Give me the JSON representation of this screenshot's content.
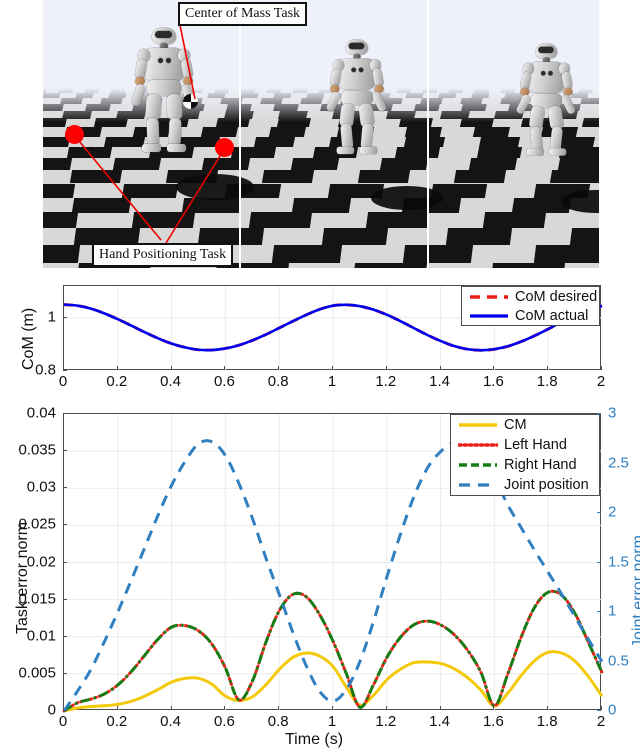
{
  "figure": {
    "photo": {
      "annotations": [
        {
          "id": "com-task",
          "label": "Center of Mass Task"
        },
        {
          "id": "hand-task",
          "label": "Hand Positioning Task"
        }
      ],
      "markers": [
        "left-hand-target",
        "right-hand-target",
        "center-of-mass-marker"
      ],
      "frames": 3
    },
    "colors": {
      "com_desired": "#e81c15",
      "com_actual": "#0000ee",
      "cm": "#f4c90a",
      "left_hand": "#e8221a",
      "right_hand": "#157d15",
      "joint_position": "#2f7fc1",
      "axis": "#4d4d4d",
      "grid": "#ebebeb"
    }
  },
  "chart_data": [
    {
      "id": "com-plot",
      "type": "line",
      "title": "",
      "xlabel": "",
      "ylabel": "CoM (m)",
      "xlim": [
        0,
        2
      ],
      "ylim": [
        0.8,
        1.12
      ],
      "xticks": [
        0,
        0.2,
        0.4,
        0.6,
        0.8,
        1,
        1.2,
        1.4,
        1.6,
        1.8,
        2
      ],
      "xticklabels": [
        "0",
        "0.2",
        "0.4",
        "0.6",
        "0.8",
        "1",
        "1.2",
        "1.4",
        "1.6",
        "1.8",
        "2"
      ],
      "yticks": [
        0.8,
        1
      ],
      "yticklabels": [
        "0.8",
        "1"
      ],
      "grid": true,
      "legend_position": "top-right",
      "legend": [
        "CoM desired",
        "CoM actual"
      ],
      "x": [
        0,
        0.05,
        0.1,
        0.15,
        0.2,
        0.25,
        0.3,
        0.35,
        0.4,
        0.45,
        0.5,
        0.55,
        0.6,
        0.65,
        0.7,
        0.75,
        0.8,
        0.85,
        0.9,
        0.95,
        1,
        1.05,
        1.1,
        1.15,
        1.2,
        1.25,
        1.3,
        1.35,
        1.4,
        1.45,
        1.5,
        1.55,
        1.6,
        1.65,
        1.7,
        1.75,
        1.8,
        1.85,
        1.9,
        1.95,
        2
      ],
      "series": [
        {
          "name": "CoM desired",
          "values": [
            1.05,
            1.046,
            1.035,
            1.017,
            0.995,
            0.971,
            0.946,
            0.923,
            0.903,
            0.889,
            0.88,
            0.879,
            0.885,
            0.897,
            0.915,
            0.937,
            0.962,
            0.987,
            1.011,
            1.032,
            1.046,
            1.049,
            1.044,
            1.031,
            1.012,
            0.988,
            0.962,
            0.936,
            0.913,
            0.894,
            0.882,
            0.878,
            0.882,
            0.893,
            0.911,
            0.933,
            0.958,
            0.984,
            1.008,
            1.029,
            1.045
          ]
        },
        {
          "name": "CoM actual",
          "values": [
            1.05,
            1.046,
            1.035,
            1.017,
            0.995,
            0.971,
            0.946,
            0.923,
            0.903,
            0.889,
            0.88,
            0.879,
            0.885,
            0.897,
            0.915,
            0.937,
            0.962,
            0.987,
            1.011,
            1.032,
            1.046,
            1.049,
            1.044,
            1.031,
            1.012,
            0.988,
            0.962,
            0.936,
            0.913,
            0.894,
            0.882,
            0.878,
            0.882,
            0.893,
            0.911,
            0.933,
            0.958,
            0.984,
            1.008,
            1.029,
            1.045
          ]
        }
      ]
    },
    {
      "id": "error-plot",
      "type": "line",
      "title": "",
      "xlabel": "Time (s)",
      "ylabel": "Task error norm",
      "ylabel_right": "Joint error norm",
      "xlim": [
        0,
        2
      ],
      "ylim": [
        0,
        0.04
      ],
      "ylim_right": [
        0,
        3
      ],
      "xticks": [
        0,
        0.2,
        0.4,
        0.6,
        0.8,
        1,
        1.2,
        1.4,
        1.6,
        1.8,
        2
      ],
      "xticklabels": [
        "0",
        "0.2",
        "0.4",
        "0.6",
        "0.8",
        "1",
        "1.2",
        "1.4",
        "1.6",
        "1.8",
        "2"
      ],
      "yticks": [
        0,
        0.005,
        0.01,
        0.015,
        0.02,
        0.025,
        0.03,
        0.035,
        0.04
      ],
      "yticklabels": [
        "0",
        "0.005",
        "0.01",
        "0.015",
        "0.02",
        "0.025",
        "0.03",
        "0.035",
        "0.04"
      ],
      "yticks_right": [
        0,
        0.5,
        1,
        1.5,
        2,
        2.5,
        3
      ],
      "yticklabels_right": [
        "0",
        "0.5",
        "1",
        "1.5",
        "2",
        "2.5",
        "3"
      ],
      "grid": true,
      "legend_position": "top-right",
      "legend": [
        "CM",
        "Left Hand",
        "Right Hand",
        "Joint position"
      ],
      "x": [
        0,
        0.05,
        0.1,
        0.15,
        0.2,
        0.25,
        0.3,
        0.35,
        0.4,
        0.45,
        0.5,
        0.55,
        0.6,
        0.65,
        0.7,
        0.75,
        0.8,
        0.85,
        0.9,
        0.95,
        1,
        1.05,
        1.1,
        1.15,
        1.2,
        1.25,
        1.3,
        1.35,
        1.4,
        1.45,
        1.5,
        1.55,
        1.6,
        1.65,
        1.7,
        1.75,
        1.8,
        1.85,
        1.9,
        1.95,
        2
      ],
      "series": [
        {
          "name": "CM",
          "axis": "left",
          "values": [
            0.0,
            0.0004,
            0.0006,
            0.0007,
            0.0009,
            0.0013,
            0.002,
            0.0029,
            0.0039,
            0.0044,
            0.0044,
            0.0036,
            0.002,
            0.0014,
            0.0019,
            0.0035,
            0.0056,
            0.0072,
            0.0078,
            0.0074,
            0.006,
            0.0032,
            0.0008,
            0.0021,
            0.0042,
            0.0056,
            0.0065,
            0.0066,
            0.0064,
            0.0057,
            0.0045,
            0.0028,
            0.0007,
            0.0024,
            0.0048,
            0.0068,
            0.0079,
            0.0078,
            0.0067,
            0.0046,
            0.002
          ]
        },
        {
          "name": "Left Hand",
          "axis": "left",
          "values": [
            0.0,
            0.0011,
            0.0016,
            0.0023,
            0.0035,
            0.0053,
            0.0075,
            0.0097,
            0.0113,
            0.0115,
            0.0108,
            0.009,
            0.0058,
            0.0015,
            0.004,
            0.0092,
            0.0135,
            0.0157,
            0.0154,
            0.013,
            0.0094,
            0.005,
            0.0005,
            0.0035,
            0.0072,
            0.0099,
            0.0116,
            0.0121,
            0.0116,
            0.0103,
            0.0082,
            0.0052,
            0.0007,
            0.005,
            0.01,
            0.014,
            0.016,
            0.0156,
            0.0131,
            0.0092,
            0.0052
          ]
        },
        {
          "name": "Right Hand",
          "axis": "left",
          "values": [
            0.0,
            0.0011,
            0.0016,
            0.0023,
            0.0035,
            0.0053,
            0.0075,
            0.0097,
            0.0113,
            0.0115,
            0.0108,
            0.009,
            0.0058,
            0.0015,
            0.004,
            0.0092,
            0.0135,
            0.0157,
            0.0154,
            0.013,
            0.0094,
            0.005,
            0.0005,
            0.0035,
            0.0072,
            0.0099,
            0.0116,
            0.0121,
            0.0116,
            0.0103,
            0.0082,
            0.0052,
            0.0007,
            0.005,
            0.01,
            0.014,
            0.016,
            0.0156,
            0.0131,
            0.0092,
            0.0052
          ]
        },
        {
          "name": "Joint position",
          "axis": "right",
          "values": [
            0.0,
            0.2,
            0.42,
            0.7,
            1.0,
            1.32,
            1.65,
            1.98,
            2.28,
            2.52,
            2.7,
            2.72,
            2.58,
            2.3,
            1.95,
            1.55,
            1.18,
            0.8,
            0.46,
            0.2,
            0.1,
            0.22,
            0.5,
            0.9,
            1.35,
            1.78,
            2.16,
            2.45,
            2.62,
            2.71,
            2.7,
            2.58,
            2.36,
            2.08,
            1.85,
            1.62,
            1.4,
            1.18,
            0.95,
            0.72,
            0.5
          ]
        }
      ]
    }
  ]
}
